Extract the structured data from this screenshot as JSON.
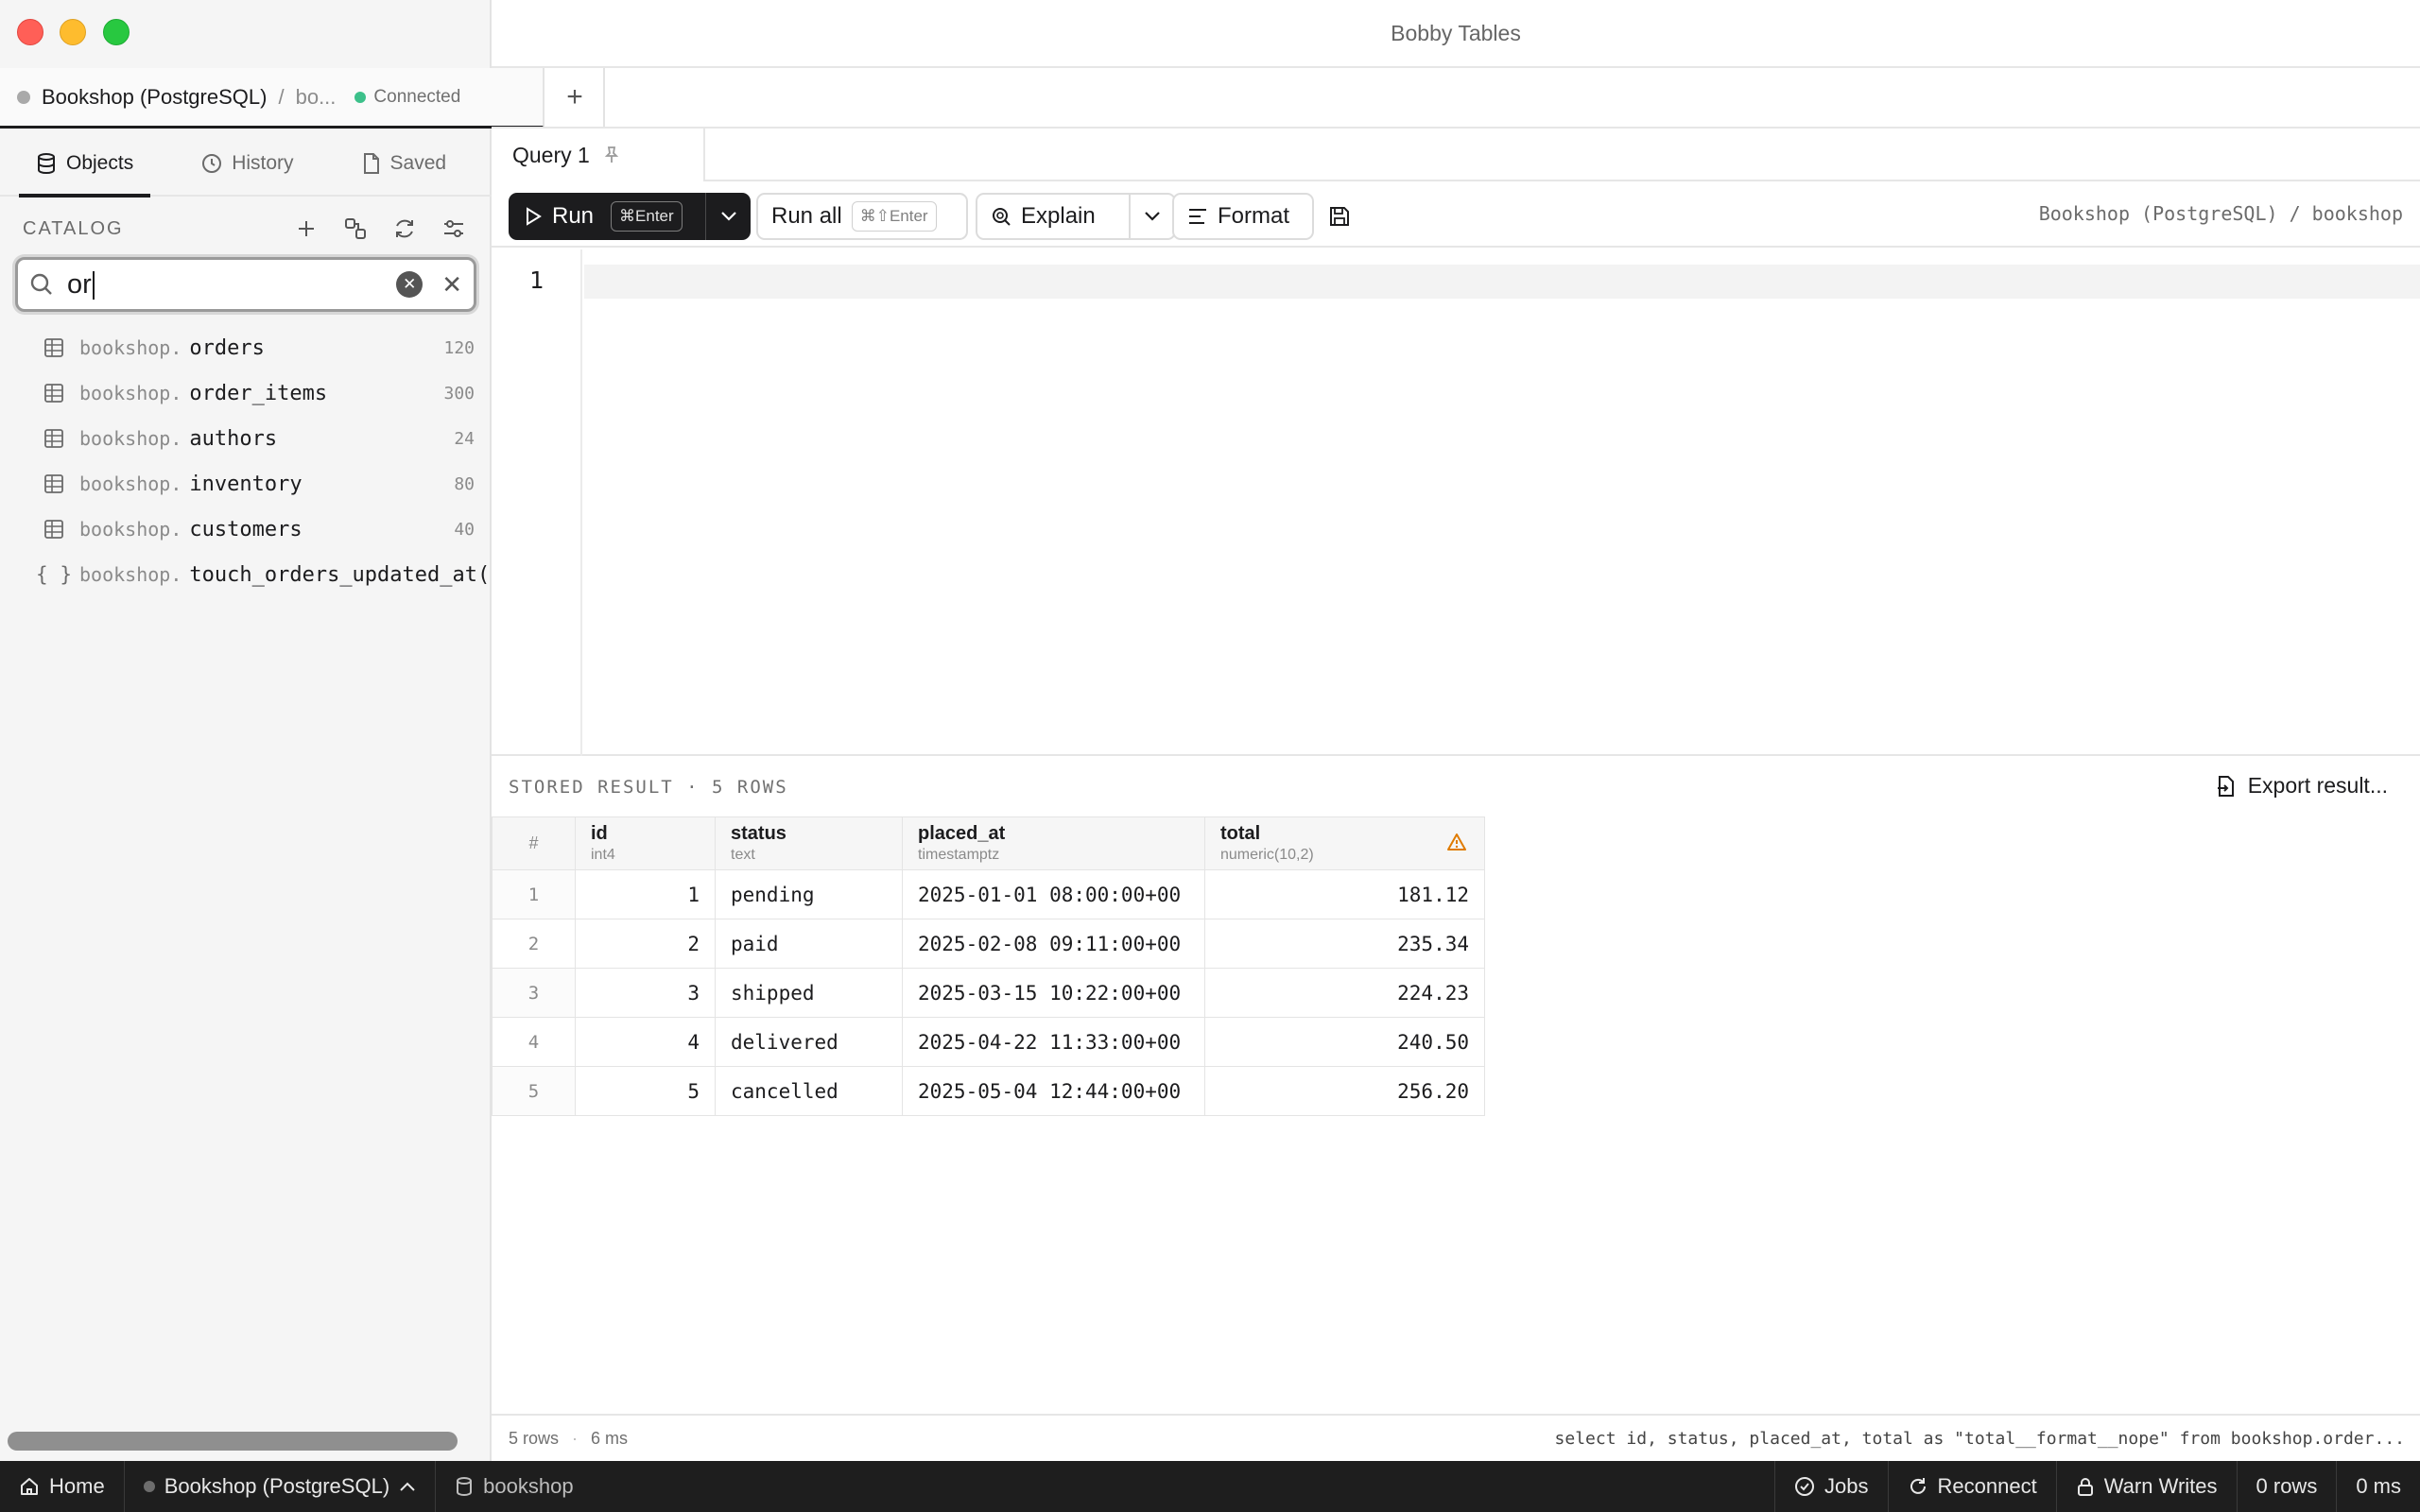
{
  "window": {
    "title": "Bobby Tables"
  },
  "connection_tab": {
    "name": "Bookshop (PostgreSQL)",
    "separator": "/",
    "database": "bo...",
    "status": "Connected",
    "add_label": "+"
  },
  "sidebar": {
    "tabs": [
      {
        "label": "Objects",
        "icon": "database-icon",
        "active": true
      },
      {
        "label": "History",
        "icon": "clock-icon",
        "active": false
      },
      {
        "label": "Saved",
        "icon": "document-icon",
        "active": false
      }
    ],
    "catalog_label": "CATALOG",
    "search": {
      "value": "or",
      "placeholder": ""
    },
    "items": [
      {
        "schema": "bookshop.",
        "name": "orders",
        "count": "120",
        "kind": "table"
      },
      {
        "schema": "bookshop.",
        "name": "order_items",
        "count": "300",
        "kind": "table"
      },
      {
        "schema": "bookshop.",
        "name": "authors",
        "count": "24",
        "kind": "table"
      },
      {
        "schema": "bookshop.",
        "name": "inventory",
        "count": "80",
        "kind": "table"
      },
      {
        "schema": "bookshop.",
        "name": "customers",
        "count": "40",
        "kind": "table"
      },
      {
        "schema": "bookshop.",
        "name": "touch_orders_updated_at(",
        "count": "",
        "kind": "function"
      }
    ]
  },
  "query_tab": {
    "label": "Query 1"
  },
  "toolbar": {
    "run_label": "Run",
    "run_shortcut": "⌘Enter",
    "run_all_label": "Run all",
    "run_all_shortcut": "⌘⇧Enter",
    "explain_label": "Explain",
    "format_label": "Format",
    "breadcrumb": "Bookshop (PostgreSQL) / bookshop"
  },
  "editor": {
    "line_number": "1"
  },
  "result": {
    "label": "STORED RESULT · 5 ROWS",
    "export_label": "Export result...",
    "hash_label": "#",
    "columns": [
      {
        "name": "id",
        "type": "int4"
      },
      {
        "name": "status",
        "type": "text"
      },
      {
        "name": "placed_at",
        "type": "timestamptz"
      },
      {
        "name": "total",
        "type": "numeric(10,2)"
      }
    ],
    "rows": [
      {
        "n": "1",
        "id": "1",
        "status": "pending",
        "placed_at": "2025-01-01 08:00:00+00",
        "total": "181.12"
      },
      {
        "n": "2",
        "id": "2",
        "status": "paid",
        "placed_at": "2025-02-08 09:11:00+00",
        "total": "235.34"
      },
      {
        "n": "3",
        "id": "3",
        "status": "shipped",
        "placed_at": "2025-03-15 10:22:00+00",
        "total": "224.23"
      },
      {
        "n": "4",
        "id": "4",
        "status": "delivered",
        "placed_at": "2025-04-22 11:33:00+00",
        "total": "240.50"
      },
      {
        "n": "5",
        "id": "5",
        "status": "cancelled",
        "placed_at": "2025-05-04 12:44:00+00",
        "total": "256.20"
      }
    ]
  },
  "status_strip": {
    "rows": "5 rows",
    "sep": "·",
    "time": "6 ms",
    "sql": "select id, status, placed_at, total as \"total__format__nope\" from bookshop.order..."
  },
  "bottom_bar": {
    "home": "Home",
    "connection": "Bookshop (PostgreSQL)",
    "database": "bookshop",
    "jobs": "Jobs",
    "reconnect": "Reconnect",
    "warn_writes": "Warn Writes",
    "rows": "0 rows",
    "time": "0 ms"
  },
  "colors": {
    "accent": "#1c1c1e",
    "connected": "#3cc08a",
    "warning": "#e07b00"
  }
}
